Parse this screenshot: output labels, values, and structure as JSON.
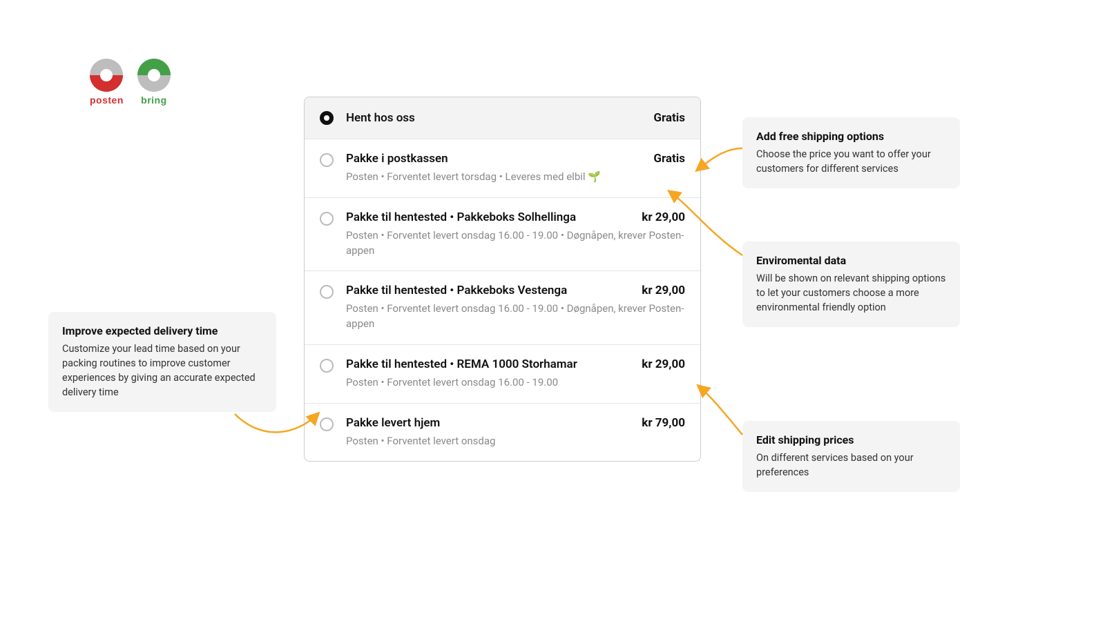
{
  "brand": {
    "posten_label": "posten",
    "bring_label": "bring"
  },
  "panel": {
    "options": [
      {
        "title": "Hent hos oss",
        "price": "Gratis",
        "sub": "",
        "selected": true
      },
      {
        "title": "Pakke i postkassen",
        "price": "Gratis",
        "sub": "Posten • Forventet levert torsdag • Leveres med elbil 🌱",
        "selected": false
      },
      {
        "title": "Pakke til hentested • Pakkeboks Solhellinga",
        "price": "kr 29,00",
        "sub": "Posten • Forventet levert onsdag 16.00 - 19.00 • Døgnåpen, krever Posten-appen",
        "selected": false
      },
      {
        "title": "Pakke til hentested • Pakkeboks Vestenga",
        "price": "kr 29,00",
        "sub": "Posten • Forventet levert onsdag 16.00 - 19.00 • Døgnåpen, krever Posten-appen",
        "selected": false
      },
      {
        "title": "Pakke til hentested • REMA 1000 Storhamar",
        "price": "kr 29,00",
        "sub": "Posten • Forventet levert onsdag 16.00 - 19.00",
        "selected": false
      },
      {
        "title": "Pakke levert hjem",
        "price": "kr 79,00",
        "sub": "Posten • Forventet levert onsdag",
        "selected": false
      }
    ]
  },
  "callouts": {
    "left": {
      "title": "Improve expected delivery time",
      "body": "Customize your lead time based on your packing routines to improve customer experiences by giving an accurate expected delivery time"
    },
    "free": {
      "title": "Add free shipping options",
      "body": "Choose the price you want to offer your customers for different services"
    },
    "env": {
      "title": "Enviromental data",
      "body": "Will be shown on relevant shipping options to let your customers choose a more environmental friendly option"
    },
    "edit": {
      "title": "Edit shipping prices",
      "body": "On different services based on your preferences"
    }
  },
  "colors": {
    "accent_arrow": "#f5a623",
    "posten_red": "#d32f2f",
    "bring_green": "#43a047",
    "logo_gray": "#bdbdbd"
  }
}
